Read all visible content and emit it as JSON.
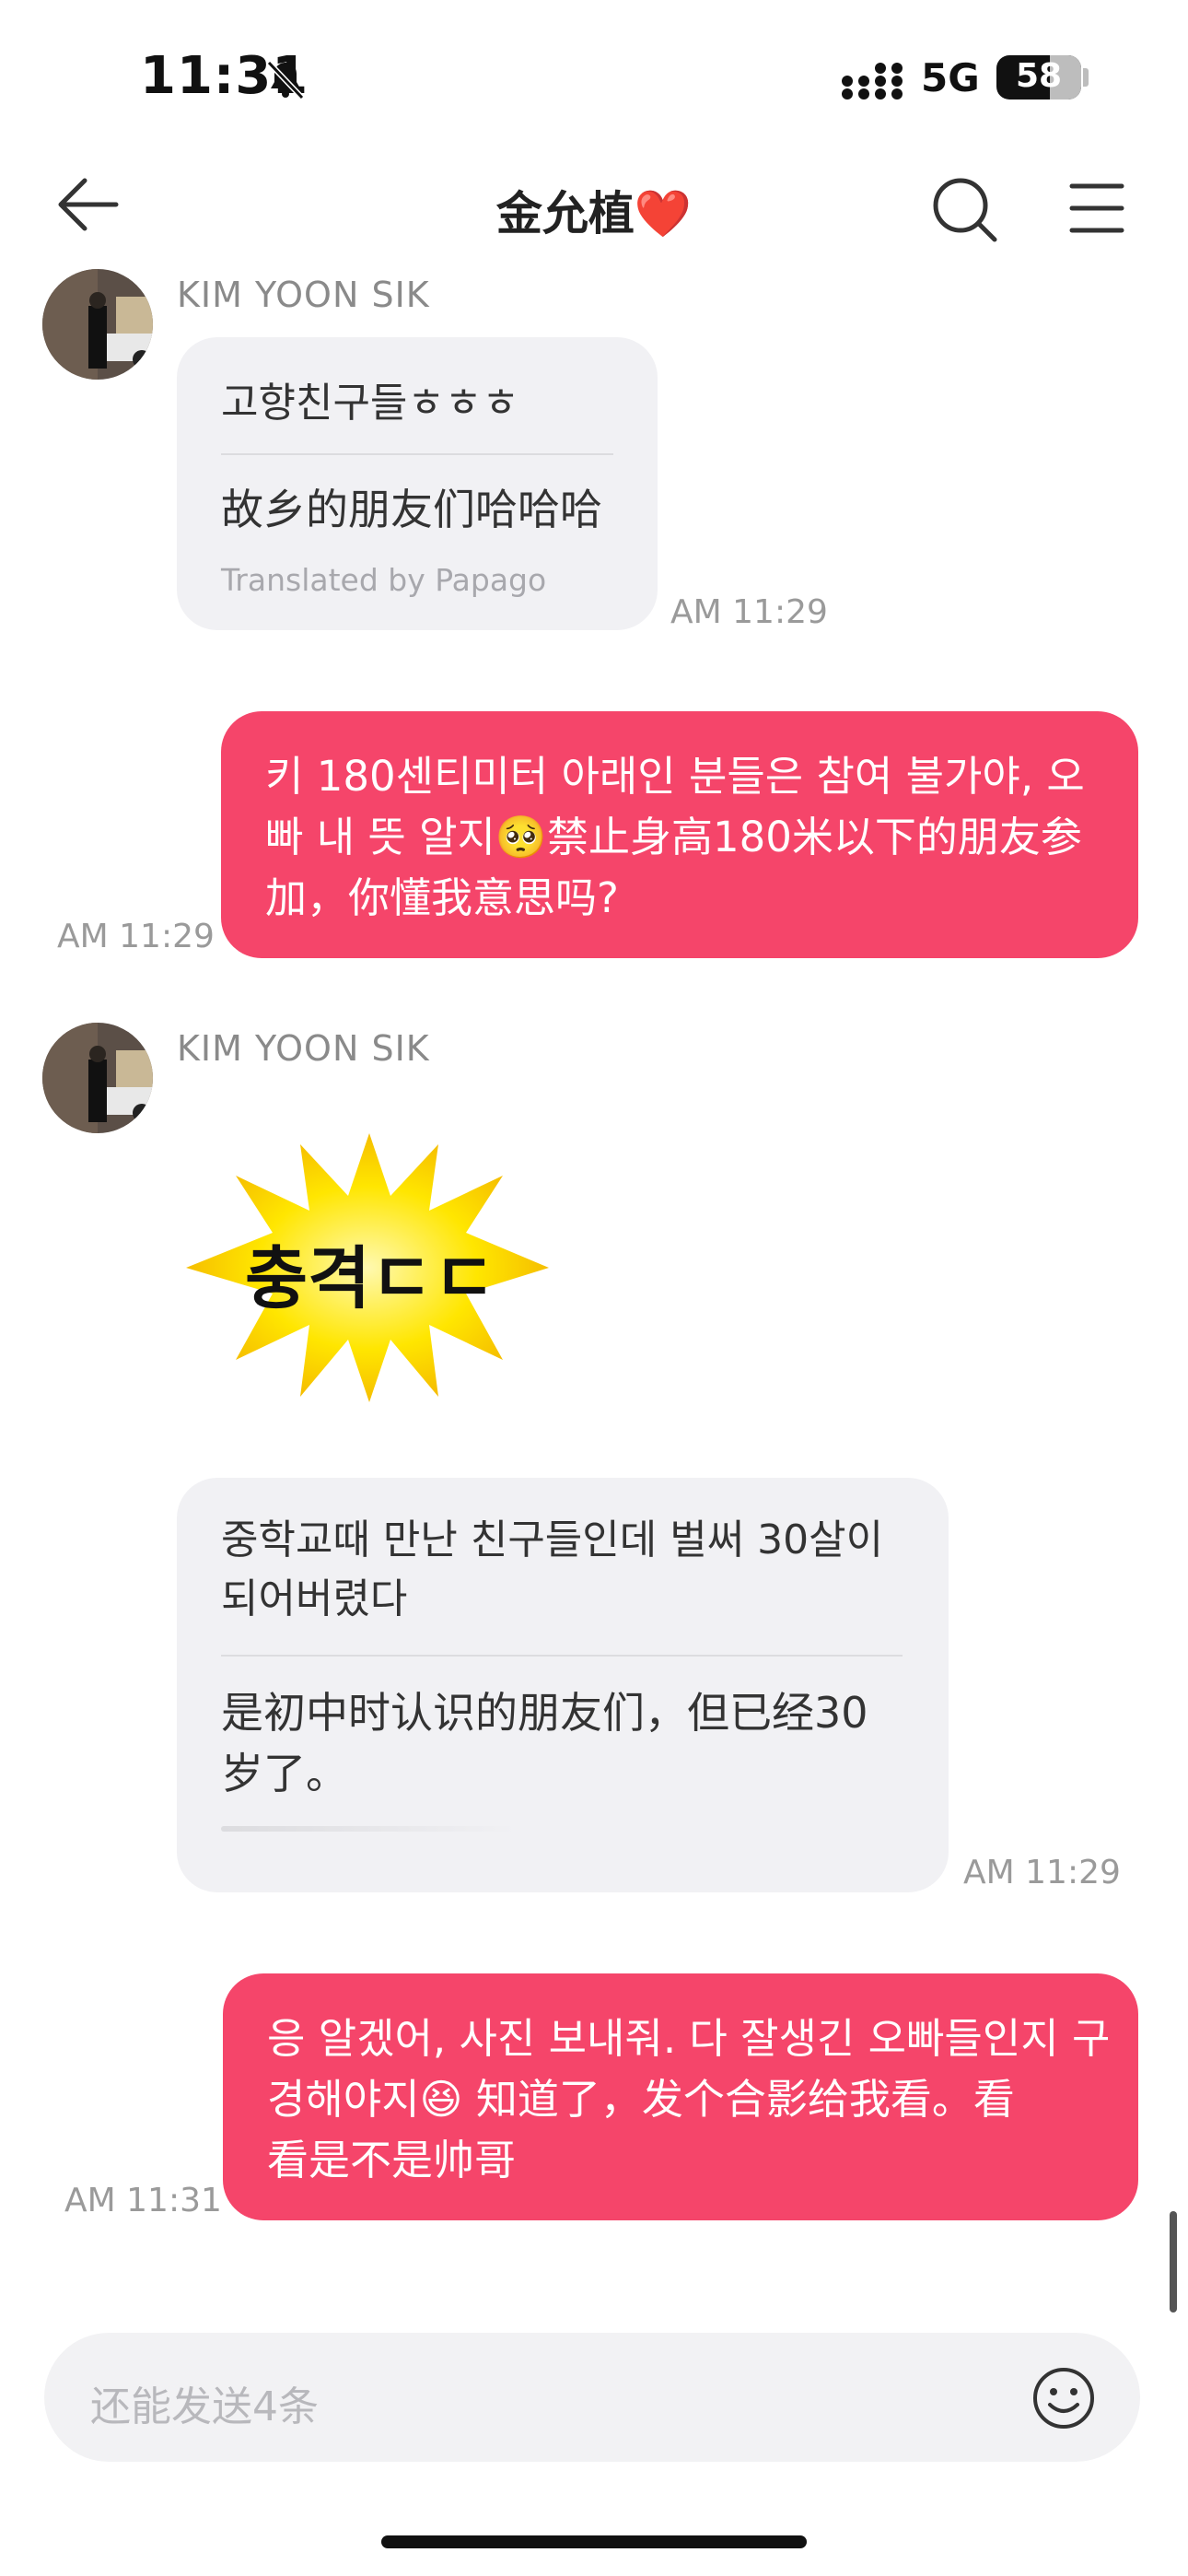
{
  "status_bar": {
    "time": "11:31",
    "network": "5G",
    "battery": "58"
  },
  "header": {
    "title": "金允植❤️"
  },
  "messages": {
    "m1": {
      "sender": "KIM YOON SIK",
      "original": "고향친구들ㅎㅎㅎ",
      "translation": "故乡的朋友们哈哈哈",
      "translated_by": "Translated by Papago",
      "time": "AM 11:29"
    },
    "m2": {
      "line1": "키 180센티미터 아래인 분들은 참여 불가야, 오",
      "line2a": "빠 내 뜻 알지",
      "line2b": "禁止身高180米以下的朋友参",
      "line3": "加，你懂我意思吗?",
      "emoji": "🥺",
      "time": "AM 11:29"
    },
    "m3": {
      "sender": "KIM YOON SIK",
      "sticker_text": "충격ㄷㄷ"
    },
    "m4": {
      "original_line1": "중학교때 만난 친구들인데 벌써 30살이",
      "original_line2": "되어버렸다",
      "translation_line1": "是初中时认识的朋友们，但已经30",
      "translation_line2": "岁了。",
      "time": "AM 11:29"
    },
    "m5": {
      "line1": "응 알겠어, 사진 보내줘. 다 잘생긴 오빠들인지 구",
      "line2a": "경해야지",
      "line2b": "知道了，发个合影给我看。看",
      "line3": "看是不是帅哥",
      "emoji": "😆",
      "time": "AM 11:31"
    }
  },
  "input": {
    "placeholder": "还能发送4条"
  },
  "icons": {
    "back": "arrow-left-icon",
    "search": "search-icon",
    "menu": "menu-icon",
    "bell": "bell-slash-icon",
    "emoji": "smiley-icon"
  },
  "colors": {
    "outgoing_bubble": "#f5456a",
    "incoming_bubble": "#f1f1f4"
  }
}
